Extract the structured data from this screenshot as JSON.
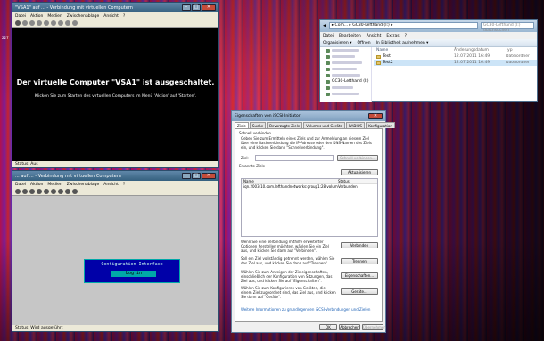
{
  "desktop": {
    "side_number": "227"
  },
  "vm1": {
    "title": "\"VSA1\" auf ... - Verbindung mit virtuellen Computern",
    "menu": [
      "Datei",
      "Aktion",
      "Medien",
      "Zwischenablage",
      "Ansicht",
      "?"
    ],
    "heading": "Der virtuelle Computer \"VSA1\" ist ausgeschaltet.",
    "subtext": "Klicken Sie zum Starten des virtuellen Computers im Menü 'Aktion' auf 'Starten'.",
    "status": "Status: Aus"
  },
  "vm2": {
    "title": "... auf ... - Verbindung mit virtuellen Computern",
    "menu": [
      "Datei",
      "Aktion",
      "Medien",
      "Zwischenablage",
      "Ansicht",
      "?"
    ],
    "console_title": "Configuration Interface",
    "console_login": "Log in",
    "status": "Status: Wird ausgeführt"
  },
  "explorer": {
    "address": "▸ Com... ▸ GC30-Lefthand (I:) ▸",
    "search_placeholder": "GC30-Lefthand (I:) durchsuchen",
    "menu": [
      "Datei",
      "Bearbeiten",
      "Ansicht",
      "Extras",
      "?"
    ],
    "commands": [
      "Organisieren ▾",
      "Öffnen",
      "In Bibliothek aufnehmen ▾"
    ],
    "nav_selected": "GC30-Lefthand (I:)",
    "headers": {
      "name": "Name",
      "date": "Änderungsdatum",
      "type": "Typ"
    },
    "files": [
      {
        "name": "Test",
        "date": "12.07.2011 16:49",
        "type": "Dateiordner"
      },
      {
        "name": "Test2",
        "date": "12.07.2011 16:49",
        "type": "Dateiordner"
      }
    ]
  },
  "iscsi": {
    "title": "Eigenschaften von iSCSI-Initiator",
    "tabs": [
      "Ziele",
      "Suche",
      "Bevorzugte Ziele",
      "Volumes und Geräte",
      "RADIUS",
      "Konfiguration"
    ],
    "quick_connect_label": "Schnell verbinden",
    "quick_connect_text": "Geben Sie zum Ermitteln eines Ziels und zur Anmeldung an diesem Ziel über eine Basisverbindung die IP-Adresse oder den DNS-Namen des Ziels ein, und klicken Sie dann \"Schnellverbindung\".",
    "target_label": "Ziel:",
    "quick_connect_btn": "Schnell verbinden...",
    "discovered_label": "Erkannte Ziele",
    "refresh_btn": "Aktualisieren",
    "col_name": "Name",
    "col_status": "Status",
    "targets": [
      {
        "name": "iqn.2003-10.com.lefthandnetworks:group1:28:volume1",
        "status": "Verbunden"
      }
    ],
    "connect_text": "Wenn Sie eine Verbindung mithilfe erweiterter Optionen herstellen möchten, wählen Sie ein Ziel aus, und klicken Sie dann auf \"Verbinden\".",
    "connect_btn": "Verbinden",
    "disconnect_text": "Soll ein Ziel vollständig getrennt werden, wählen Sie das Ziel aus, und klicken Sie dann auf \"Trennen\".",
    "disconnect_btn": "Trennen",
    "properties_text": "Wählen Sie zum Anzeigen der Zieleigenschaften, einschließlich der Konfiguration von Sitzungen, das Ziel aus, und klicken Sie auf \"Eigenschaften\".",
    "properties_btn": "Eigenschaften...",
    "devices_text": "Wählen Sie zum Konfigurieren von Geräten, die einem Ziel zugeordnet sind, das Ziel aus, und klicken Sie dann auf \"Geräte\".",
    "devices_btn": "Geräte...",
    "link": "Weitere Informationen zu grundlegenden iSCSI-Verbindungen und Zielen",
    "ok_btn": "OK",
    "cancel_btn": "Abbrechen",
    "apply_btn": "Übernehmen"
  }
}
